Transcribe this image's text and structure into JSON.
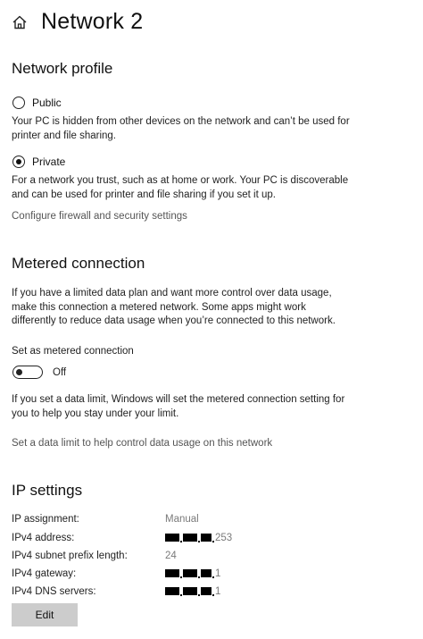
{
  "header": {
    "title": "Network 2",
    "home_icon": "home-icon"
  },
  "network_profile": {
    "title": "Network profile",
    "options": [
      {
        "label": "Public",
        "checked": false,
        "description": "Your PC is hidden from other devices on the network and can’t be used for printer and file sharing."
      },
      {
        "label": "Private",
        "checked": true,
        "description": "For a network you trust, such as at home or work. Your PC is discoverable and can be used for printer and file sharing if you set it up."
      }
    ],
    "firewall_link": "Configure firewall and security settings"
  },
  "metered": {
    "title": "Metered connection",
    "description": "If you have a limited data plan and want more control over data usage, make this connection a metered network. Some apps might work differently to reduce data usage when you’re connected to this network.",
    "toggle_label": "Set as metered connection",
    "toggle_state": "Off",
    "data_limit_note": "If you set a data limit, Windows will set the metered connection setting for you to help you stay under your limit.",
    "data_limit_link": "Set a data limit to help control data usage on this network"
  },
  "ip_settings": {
    "title": "IP settings",
    "assignment_label": "IP assignment:",
    "assignment_value": "Manual",
    "ipv4_address_label": "IPv4 address:",
    "ipv4_address_suffix": "253",
    "prefix_label": "IPv4 subnet prefix length:",
    "prefix_value": "24",
    "gateway_label": "IPv4 gateway:",
    "gateway_suffix": "1",
    "dns_label": "IPv4 DNS servers:",
    "dns_suffix": "1",
    "edit_label": "Edit"
  }
}
